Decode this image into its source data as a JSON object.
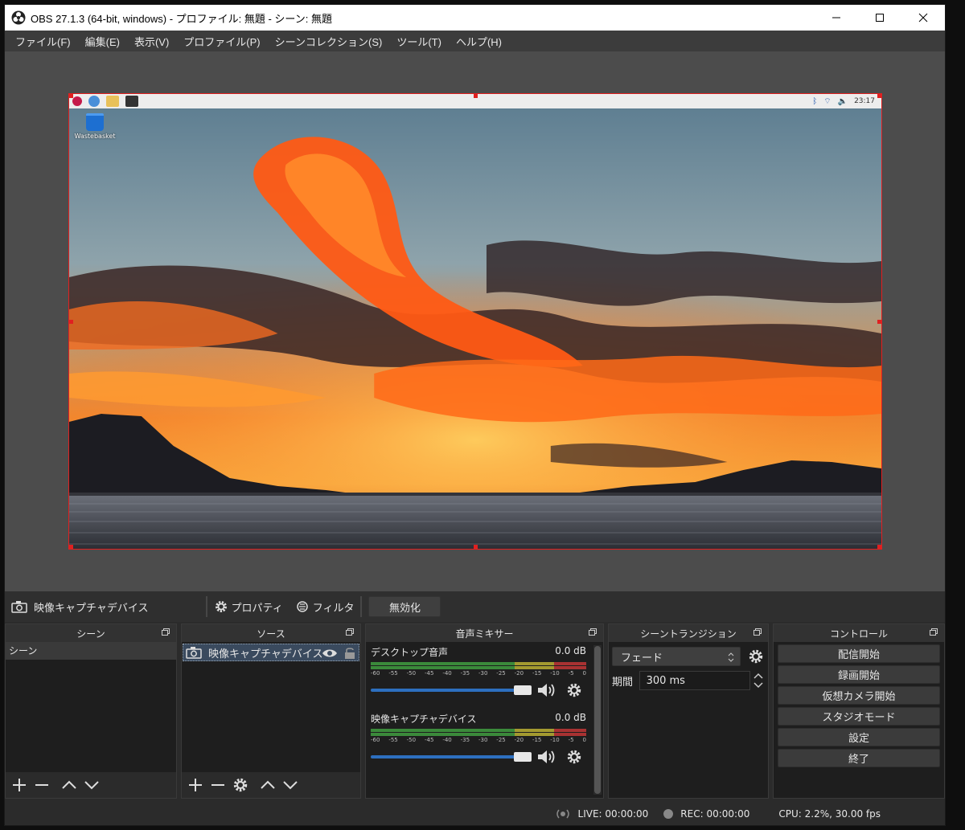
{
  "titlebar": {
    "title": "OBS 27.1.3 (64-bit, windows) - プロファイル: 無題 - シーン: 無題"
  },
  "menu": [
    "ファイル(F)",
    "編集(E)",
    "表示(V)",
    "プロファイル(P)",
    "シーンコレクション(S)",
    "ツール(T)",
    "ヘルプ(H)"
  ],
  "preview": {
    "taskbar_clock": "23:17",
    "desktop_icon_label": "Wastebasket"
  },
  "source_toolbar": {
    "source_name": "映像キャプチャデバイス",
    "properties": "プロパティ",
    "filters": "フィルタ",
    "disable": "無効化"
  },
  "docks": {
    "scenes": {
      "title": "シーン",
      "items": [
        "シーン"
      ]
    },
    "sources": {
      "title": "ソース",
      "items": [
        "映像キャプチャデバイス"
      ]
    },
    "mixer": {
      "title": "音声ミキサー",
      "ticks": [
        "-60",
        "-55",
        "-50",
        "-45",
        "-40",
        "-35",
        "-30",
        "-25",
        "-20",
        "-15",
        "-10",
        "-5",
        "0"
      ],
      "channels": [
        {
          "name": "デスクトップ音声",
          "db": "0.0 dB",
          "volume": 1.0
        },
        {
          "name": "映像キャプチャデバイス",
          "db": "0.0 dB",
          "volume": 1.0
        }
      ]
    },
    "transitions": {
      "title": "シーントランジション",
      "type": "フェード",
      "duration_label": "期間",
      "duration_value": "300 ms"
    },
    "controls": {
      "title": "コントロール",
      "buttons": [
        "配信開始",
        "録画開始",
        "仮想カメラ開始",
        "スタジオモード",
        "設定",
        "終了"
      ]
    }
  },
  "status": {
    "live": "LIVE: 00:00:00",
    "rec": "REC: 00:00:00",
    "cpu": "CPU: 2.2%, 30.00 fps"
  },
  "colors": {
    "selection_red": "#e02020",
    "fader_blue": "#2d6fbf"
  }
}
